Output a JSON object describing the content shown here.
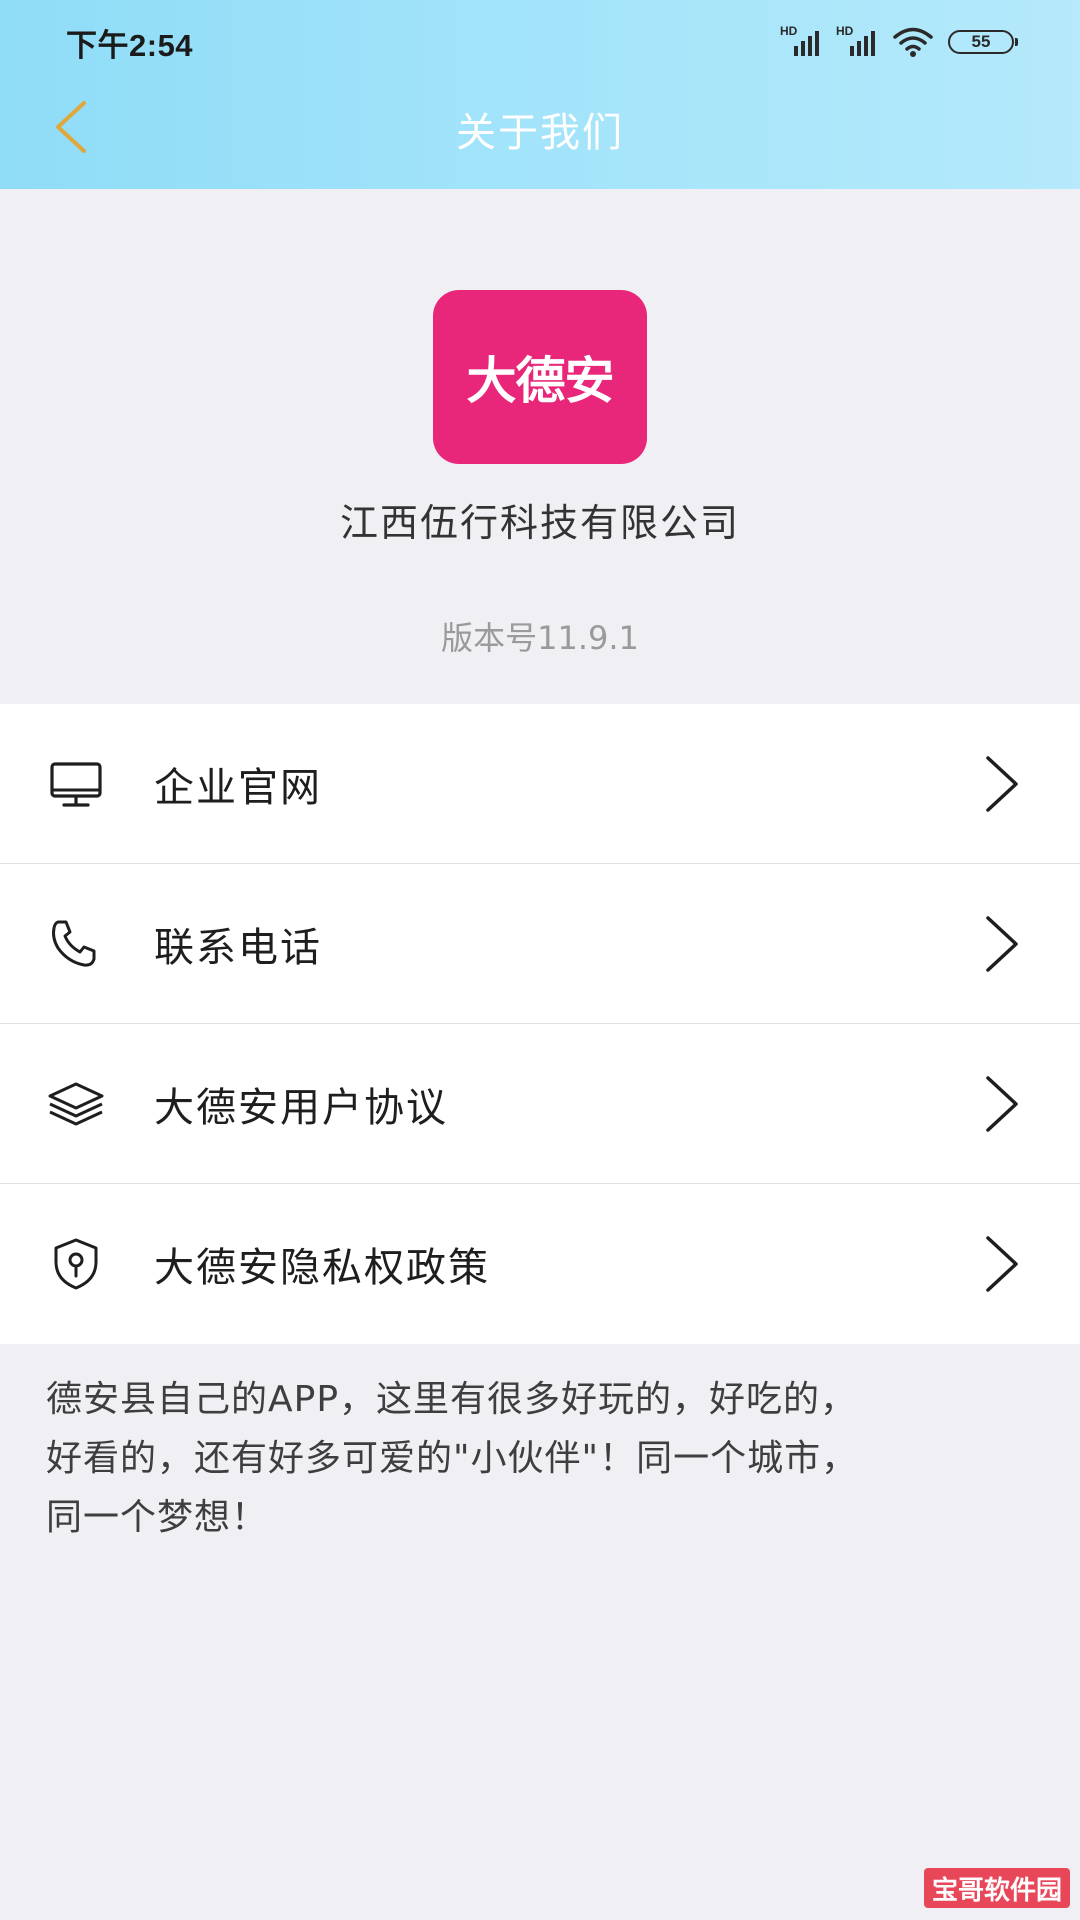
{
  "status_bar": {
    "time": "下午2:54",
    "signal_label": "HD",
    "battery": "55"
  },
  "nav": {
    "title": "关于我们"
  },
  "app": {
    "logo_text": "大德安",
    "company": "江西伍行科技有限公司",
    "version": "版本号11.9.1"
  },
  "menu": {
    "items": [
      {
        "label": "企业官网",
        "icon": "monitor-icon"
      },
      {
        "label": "联系电话",
        "icon": "phone-icon"
      },
      {
        "label": "大德安用户协议",
        "icon": "layers-icon"
      },
      {
        "label": "大德安隐私权政策",
        "icon": "shield-key-icon"
      }
    ]
  },
  "description": {
    "line1": "德安县自己的APP，这里有很多好玩的，好吃的，",
    "line2": "好看的，还有好多可爱的\"小伙伴\"！同一个城市，",
    "line3": "同一个梦想！"
  },
  "watermark": {
    "text": "宝哥软件园"
  },
  "colors": {
    "header_gradient_start": "#8fdcf7",
    "header_gradient_end": "#b5e9fb",
    "back_arrow": "#e0a73c",
    "logo_bg": "#e8277a",
    "page_bg": "#f0eff4"
  }
}
